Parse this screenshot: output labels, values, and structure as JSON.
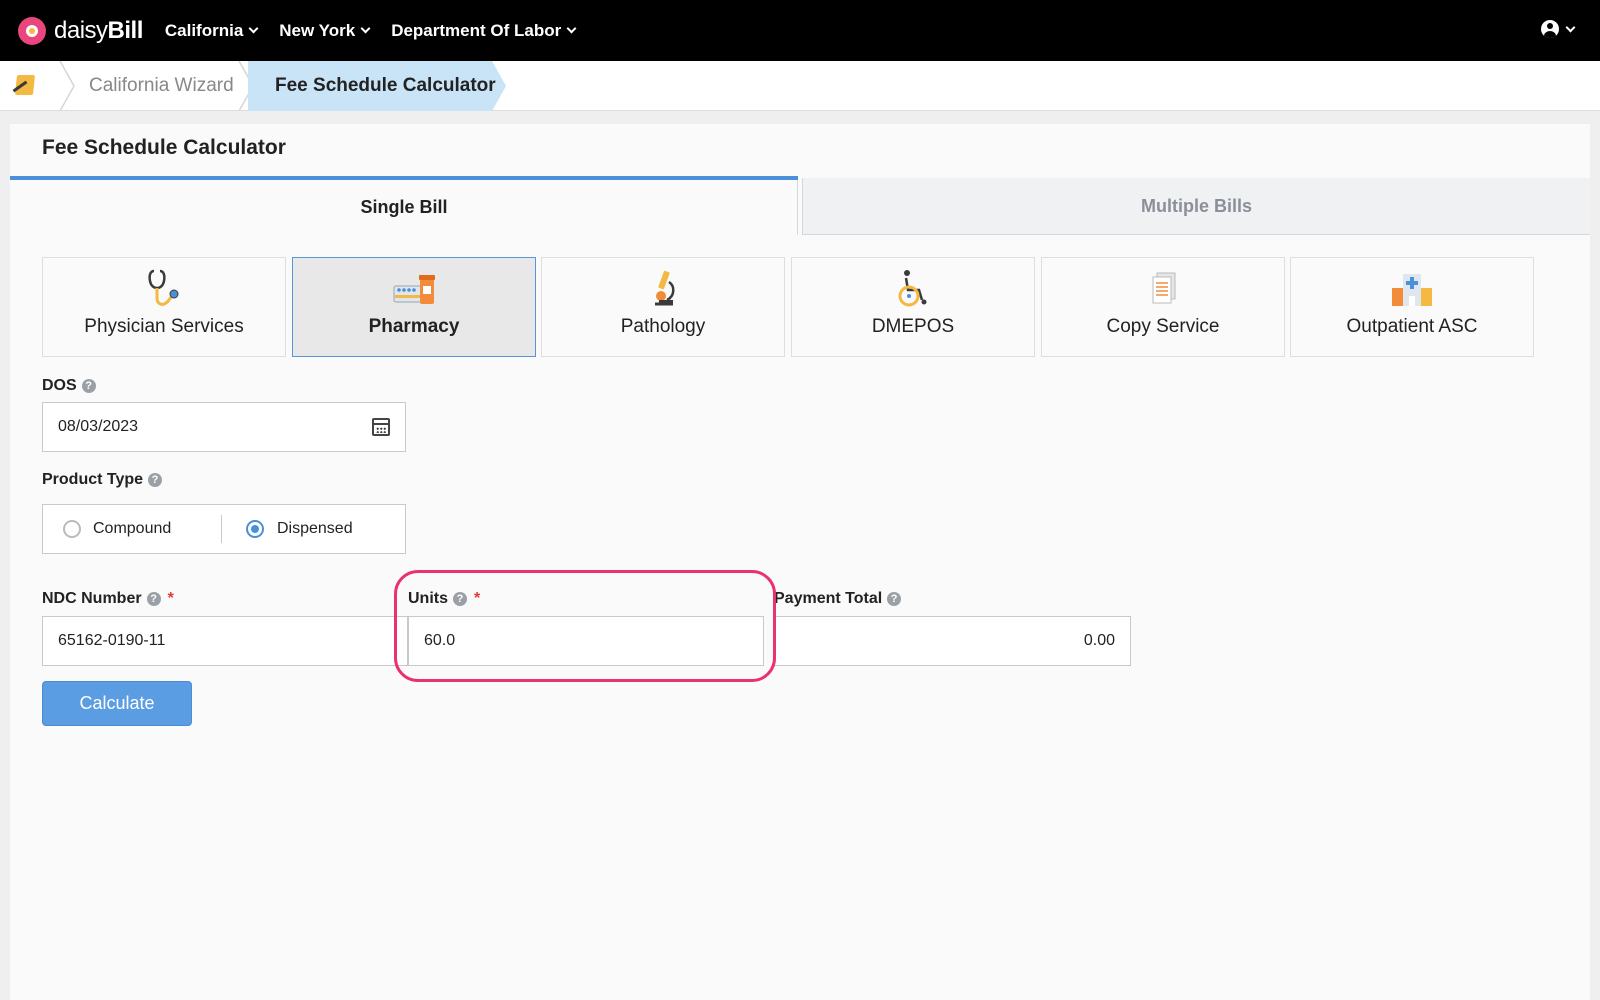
{
  "app": {
    "brand_light": "daisy",
    "brand_bold": "Bill"
  },
  "nav": {
    "items": [
      {
        "label": "California"
      },
      {
        "label": "New York"
      },
      {
        "label": "Department Of Labor"
      }
    ]
  },
  "breadcrumb": {
    "items": [
      "California Wizard",
      "Fee Schedule Calculator"
    ]
  },
  "page": {
    "title": "Fee Schedule Calculator"
  },
  "tabs": [
    {
      "label": "Single Bill",
      "active": true
    },
    {
      "label": "Multiple Bills",
      "active": false
    }
  ],
  "services": [
    {
      "label": "Physician Services",
      "icon": "stethoscope-icon",
      "active": false
    },
    {
      "label": "Pharmacy",
      "icon": "pills-icon",
      "active": true
    },
    {
      "label": "Pathology",
      "icon": "microscope-icon",
      "active": false
    },
    {
      "label": "DMEPOS",
      "icon": "wheelchair-icon",
      "active": false
    },
    {
      "label": "Copy Service",
      "icon": "document-icon",
      "active": false
    },
    {
      "label": "Outpatient ASC",
      "icon": "hospital-icon",
      "active": false
    }
  ],
  "form": {
    "dos": {
      "label": "DOS",
      "value": "08/03/2023"
    },
    "product_type": {
      "label": "Product Type",
      "options": [
        {
          "label": "Compound",
          "checked": false
        },
        {
          "label": "Dispensed",
          "checked": true
        }
      ]
    },
    "ndc": {
      "label": "NDC Number",
      "required": "*",
      "value": "65162-0190-11"
    },
    "units": {
      "label": "Units",
      "required": "*",
      "value": "60.0"
    },
    "payment_total": {
      "label": "Payment Total",
      "value": "0.00"
    },
    "calculate_label": "Calculate",
    "help_glyph": "?"
  },
  "colors": {
    "accent": "#4a90d9",
    "highlight": "#e8336f",
    "topbar": "#000000",
    "breadcrumb_active": "#c9e3f7",
    "required": "#e53935"
  }
}
